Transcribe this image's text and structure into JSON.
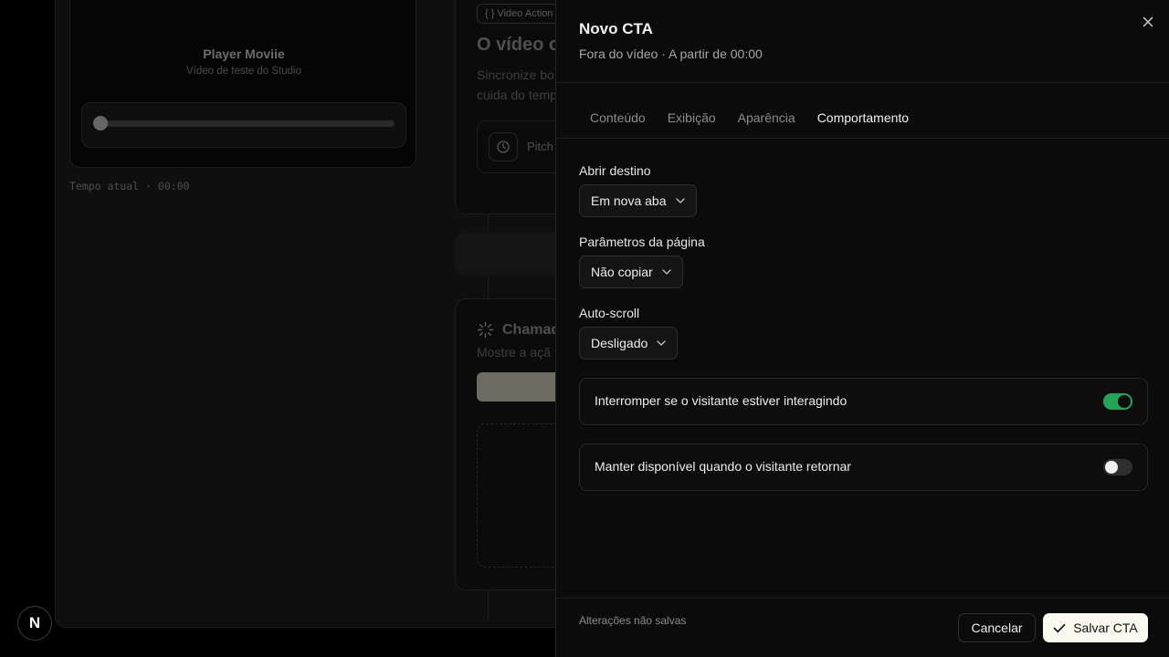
{
  "background": {
    "player": {
      "title": "Player Moviie",
      "subtitle": "Vídeo de teste do Studio",
      "progress": 0
    },
    "time_label": "Tempo atual · 00:00",
    "video_actions_chip": "Video Action",
    "heading": "O vídeo c",
    "desc_line1": "Sincronize bo",
    "desc_line2": "cuida do temp",
    "pitch_label": "Pitch",
    "cta_title": "Chamad",
    "cta_desc": "Mostre a açã"
  },
  "logo_letter": "N",
  "panel": {
    "title": "Novo CTA",
    "subtitle": "Fora do vídeo · A partir de 00:00",
    "tabs": [
      {
        "label": "Conteúdo",
        "active": false
      },
      {
        "label": "Exibição",
        "active": false
      },
      {
        "label": "Aparência",
        "active": false
      },
      {
        "label": "Comportamento",
        "active": true
      }
    ],
    "fields": {
      "open_target": {
        "label": "Abrir destino",
        "value": "Em nova aba"
      },
      "page_params": {
        "label": "Parâmetros da página",
        "value": "Não copiar"
      },
      "auto_scroll": {
        "label": "Auto-scroll",
        "value": "Desligado"
      }
    },
    "toggles": {
      "interrupt": {
        "label": "Interromper se o visitante estiver interagindo",
        "on": true
      },
      "keep_available": {
        "label": "Manter disponível quando o visitante retornar",
        "on": false
      }
    },
    "footer": {
      "status": "Alterações não salvas",
      "cancel_label": "Cancelar",
      "save_label": "Salvar CTA"
    }
  },
  "colors": {
    "accent_green": "#23a559",
    "save_button": "#fbfaf0"
  }
}
